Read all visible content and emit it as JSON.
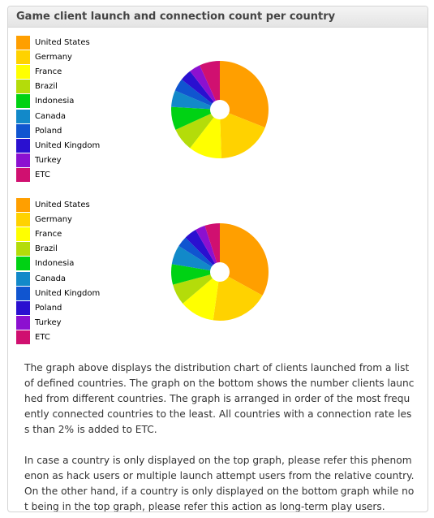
{
  "panel": {
    "title": "Game client launch and connection count per country"
  },
  "colors": [
    "#ff9f00",
    "#ffd200",
    "#ffff00",
    "#b4dc0a",
    "#00d214",
    "#1289c9",
    "#1055d0",
    "#2a10d0",
    "#8c10d0",
    "#d01070"
  ],
  "chart_data": [
    {
      "type": "pie",
      "title": "",
      "categories": [
        "United States",
        "Germany",
        "France",
        "Brazil",
        "Indonesia",
        "Canada",
        "Poland",
        "United Kingdom",
        "Turkey",
        "ETC"
      ],
      "values": [
        31,
        18.5,
        11,
        7.7,
        7.7,
        5.5,
        4.2,
        3.9,
        3.7,
        6.8
      ],
      "legend": "left",
      "donut_hole": true
    },
    {
      "type": "pie",
      "title": "",
      "categories": [
        "United States",
        "Germany",
        "France",
        "Brazil",
        "Indonesia",
        "Canada",
        "United Kingdom",
        "Poland",
        "Turkey",
        "ETC"
      ],
      "values": [
        33,
        19.2,
        11.6,
        7,
        6.8,
        6.4,
        3.5,
        4.2,
        3.3,
        5
      ],
      "legend": "left",
      "donut_hole": true
    }
  ],
  "description": [
    "The graph above displays the distribution chart of clients launched from a list of defined countries. The graph on the bottom shows the number clients launched from different countries. The graph is arranged in order of the most frequently connected countries to the least. All countries with a connection rate less than 2% is added to ETC.",
    "In case a country is only displayed on the top graph, please refer this phenomenon as hack users or multiple launch attempt users from the relative country. On the other hand, if a country is only displayed on the bottom graph while not being in the top graph, please refer this action as long-term play users."
  ]
}
